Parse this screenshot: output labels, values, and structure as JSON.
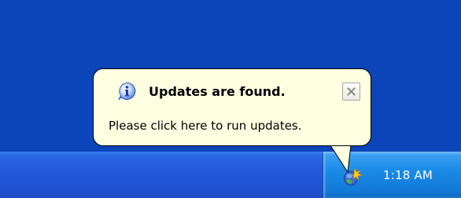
{
  "balloon": {
    "title": "Updates are found.",
    "message": "Please click here to run updates.",
    "icon": "info-icon",
    "close_icon": "close-icon",
    "background": "#ffffe1"
  },
  "taskbar": {
    "color": "#2458d8"
  },
  "tray": {
    "clock": "1:18 AM",
    "icon": "windows-update-icon",
    "color": "#1a8be6"
  },
  "desktop": {
    "color": "#0a45b9"
  }
}
